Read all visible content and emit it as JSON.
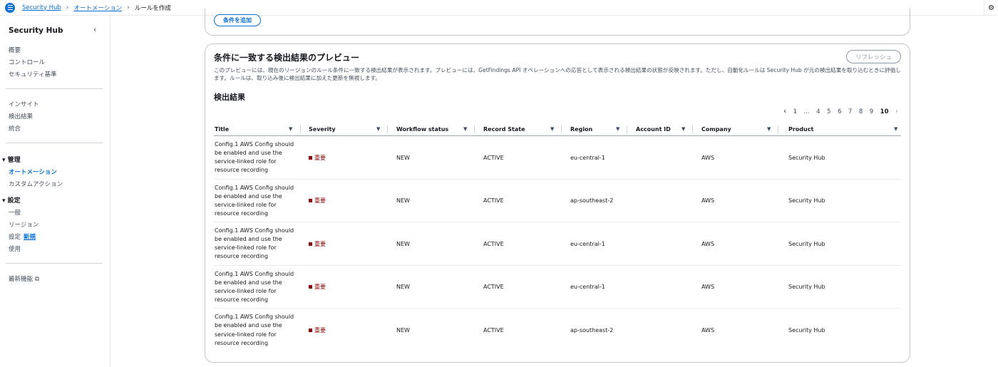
{
  "breadcrumb": {
    "items": [
      "Security Hub",
      "オートメーション"
    ],
    "current": "ルールを作成"
  },
  "sidebar": {
    "title": "Security Hub",
    "group1": [
      "概要",
      "コントロール",
      "セキュリティ基準"
    ],
    "group2": [
      "インサイト",
      "検出結果",
      "統合"
    ],
    "manage_section": "管理",
    "manage_items": [
      "オートメーション",
      "カスタムアクション"
    ],
    "settings_section": "設定",
    "settings_items": [
      "一般",
      "リージョン",
      "設定",
      "使用"
    ],
    "new_badge": "新規",
    "latest_features": "最新機能"
  },
  "top_panel": {
    "add_condition_label": "条件を追加"
  },
  "preview": {
    "title": "条件に一致する検出結果のプレビュー",
    "refresh_label": "リフレッシュ",
    "description": "このプレビューには、現在のリージョンのルール条件に一致する検出結果が表示されます。プレビューには、GetFindings API オペレーションへの応答として表示される検出結果の状態が反映されます。ただし、自動化ルールは Security Hub が元の検出結果を取り込むときに評価します。ルールは、取り込み後に検出結果に加えた更新を無視します。",
    "results_heading": "検出結果"
  },
  "pagination": {
    "pages": [
      "1",
      "...",
      "4",
      "5",
      "6",
      "7",
      "8",
      "9",
      "10"
    ],
    "current": "10"
  },
  "table": {
    "columns": [
      "Title",
      "Severity",
      "Workflow status",
      "Record State",
      "Region",
      "Account ID",
      "Company",
      "Product"
    ],
    "rows": [
      {
        "title": "Config.1 AWS Config should be enabled and use the service-linked role for resource recording",
        "severity": "重要",
        "workflow": "NEW",
        "record_state": "ACTIVE",
        "region": "eu-central-1",
        "account_id": "",
        "company": "AWS",
        "product": "Security Hub"
      },
      {
        "title": "Config.1 AWS Config should be enabled and use the service-linked role for resource recording",
        "severity": "重要",
        "workflow": "NEW",
        "record_state": "ACTIVE",
        "region": "ap-southeast-2",
        "account_id": "",
        "company": "AWS",
        "product": "Security Hub"
      },
      {
        "title": "Config.1 AWS Config should be enabled and use the service-linked role for resource recording",
        "severity": "重要",
        "workflow": "NEW",
        "record_state": "ACTIVE",
        "region": "eu-central-1",
        "account_id": "",
        "company": "AWS",
        "product": "Security Hub"
      },
      {
        "title": "Config.1 AWS Config should be enabled and use the service-linked role for resource recording",
        "severity": "重要",
        "workflow": "NEW",
        "record_state": "ACTIVE",
        "region": "eu-central-1",
        "account_id": "",
        "company": "AWS",
        "product": "Security Hub"
      },
      {
        "title": "Config.1 AWS Config should be enabled and use the service-linked role for resource recording",
        "severity": "重要",
        "workflow": "NEW",
        "record_state": "ACTIVE",
        "region": "ap-southeast-2",
        "account_id": "",
        "company": "AWS",
        "product": "Security Hub"
      }
    ]
  },
  "colors": {
    "link": "#0972d3",
    "severity_high": "#8d0a0a",
    "border": "#c6c6cd"
  },
  "icons": [
    "menu-icon",
    "chevron-right-icon",
    "collapse-chevron-icon",
    "external-link-icon",
    "sort-caret-icon",
    "pager-prev-icon",
    "pager-next-icon",
    "settings-icon"
  ]
}
